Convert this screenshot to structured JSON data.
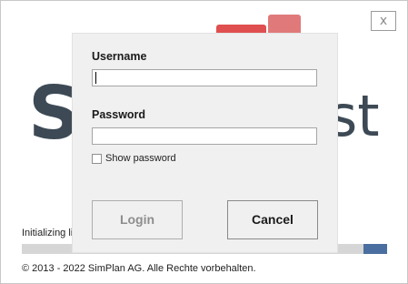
{
  "window": {
    "close_label": "x"
  },
  "splash": {
    "logo_left_text": "S",
    "logo_right_text": "st",
    "status_text": "Initializing lic",
    "progress_value": 0.065,
    "copyright": "© 2013 - 2022 SimPlan AG. Alle Rechte vorbehalten.",
    "colors": {
      "logo_red": "#e04f4f",
      "logo_pink": "#e07a7a",
      "logo_gray": "#3d4a55",
      "progress_fill": "#4a6ea0"
    }
  },
  "login": {
    "username_label": "Username",
    "username_value": "",
    "password_label": "Password",
    "password_value": "",
    "show_password_label": "Show password",
    "show_password_checked": false,
    "login_button": "Login",
    "cancel_button": "Cancel"
  }
}
